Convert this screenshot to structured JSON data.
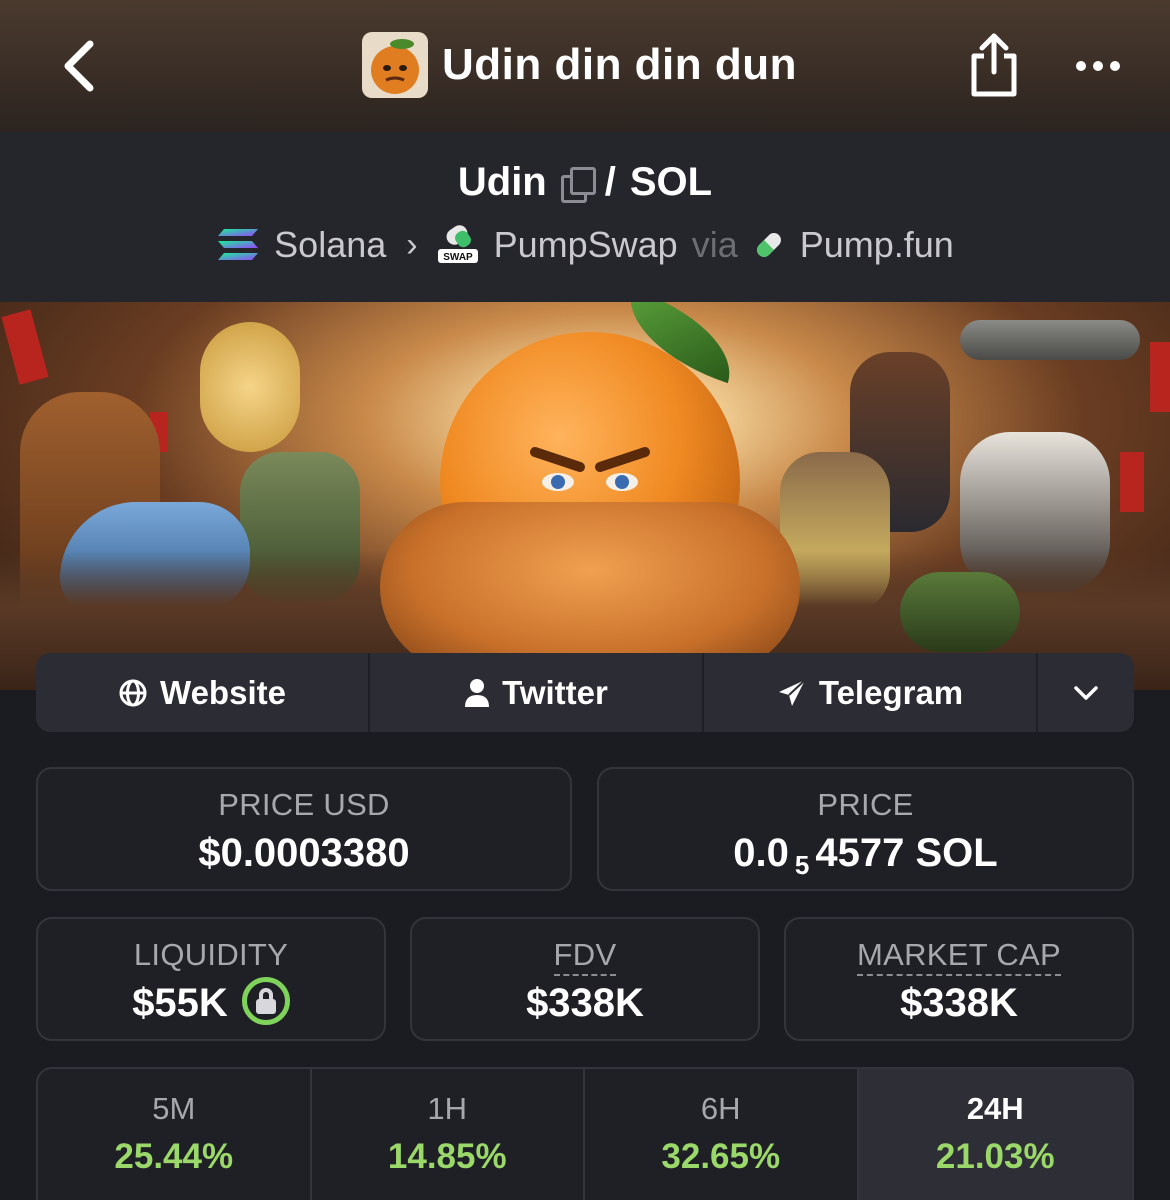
{
  "header": {
    "title": "Udin din din dun",
    "back_icon": "chevron-left-icon",
    "share_icon": "share-icon",
    "more_icon": "more-dots-icon"
  },
  "pair": {
    "base": "Udin",
    "separator": "/",
    "quote": "SOL",
    "chain": "Solana",
    "dex": "PumpSwap",
    "via": "via",
    "launchpad": "Pump.fun"
  },
  "links": {
    "website": "Website",
    "twitter": "Twitter",
    "telegram": "Telegram"
  },
  "stats": {
    "price_usd_label": "PRICE USD",
    "price_usd_value": "$0.0003380",
    "price_label": "PRICE",
    "price_prefix": "0.0",
    "price_sub": "5",
    "price_suffix": "4577 SOL",
    "liquidity_label": "LIQUIDITY",
    "liquidity_value": "$55K",
    "fdv_label": "FDV",
    "fdv_value": "$338K",
    "mcap_label": "MARKET CAP",
    "mcap_value": "$338K"
  },
  "changes": [
    {
      "label": "5M",
      "value": "25.44%"
    },
    {
      "label": "1H",
      "value": "14.85%"
    },
    {
      "label": "6H",
      "value": "32.65%"
    },
    {
      "label": "24H",
      "value": "21.03%"
    }
  ],
  "colors": {
    "positive": "#9bd86a",
    "lock_ring": "#7fd35a",
    "background": "#1b1b22"
  }
}
